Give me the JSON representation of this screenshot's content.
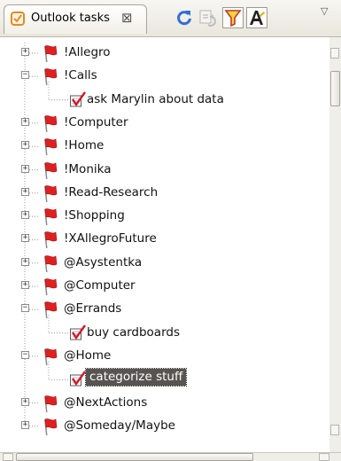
{
  "view": {
    "title": "Outlook tasks",
    "close_glyph": "⊠",
    "icon": "outlook-tasks-icon",
    "menu_glyph": "▽"
  },
  "toolbar": {
    "buttons": [
      {
        "name": "refresh-icon"
      },
      {
        "name": "sync-icon"
      },
      {
        "name": "filter-icon",
        "pressed": true
      },
      {
        "name": "font-icon",
        "pressed": true
      }
    ]
  },
  "colors": {
    "flag_red": "#e02020",
    "selection_bg": "#575451",
    "toggle_border": "#8c8c8c"
  },
  "tree": {
    "rows": [
      {
        "kind": "category",
        "label": "!Allegro",
        "expanded": false
      },
      {
        "kind": "category",
        "label": "!Calls",
        "expanded": true
      },
      {
        "kind": "task",
        "label": "ask Marylin about data"
      },
      {
        "kind": "category",
        "label": "!Computer",
        "expanded": false
      },
      {
        "kind": "category",
        "label": "!Home",
        "expanded": false
      },
      {
        "kind": "category",
        "label": "!Monika",
        "expanded": false
      },
      {
        "kind": "category",
        "label": "!Read-Research",
        "expanded": false
      },
      {
        "kind": "category",
        "label": "!Shopping",
        "expanded": false
      },
      {
        "kind": "category",
        "label": "!XAllegroFuture",
        "expanded": false
      },
      {
        "kind": "category",
        "label": "@Asystentka",
        "expanded": false
      },
      {
        "kind": "category",
        "label": "@Computer",
        "expanded": false
      },
      {
        "kind": "category",
        "label": "@Errands",
        "expanded": true
      },
      {
        "kind": "task",
        "label": "buy cardboards"
      },
      {
        "kind": "category",
        "label": "@Home",
        "expanded": true
      },
      {
        "kind": "task",
        "label": "categorize stuff",
        "selected": true
      },
      {
        "kind": "category",
        "label": "@NextActions",
        "expanded": false
      },
      {
        "kind": "category",
        "label": "@Someday/Maybe",
        "expanded": false
      }
    ]
  }
}
